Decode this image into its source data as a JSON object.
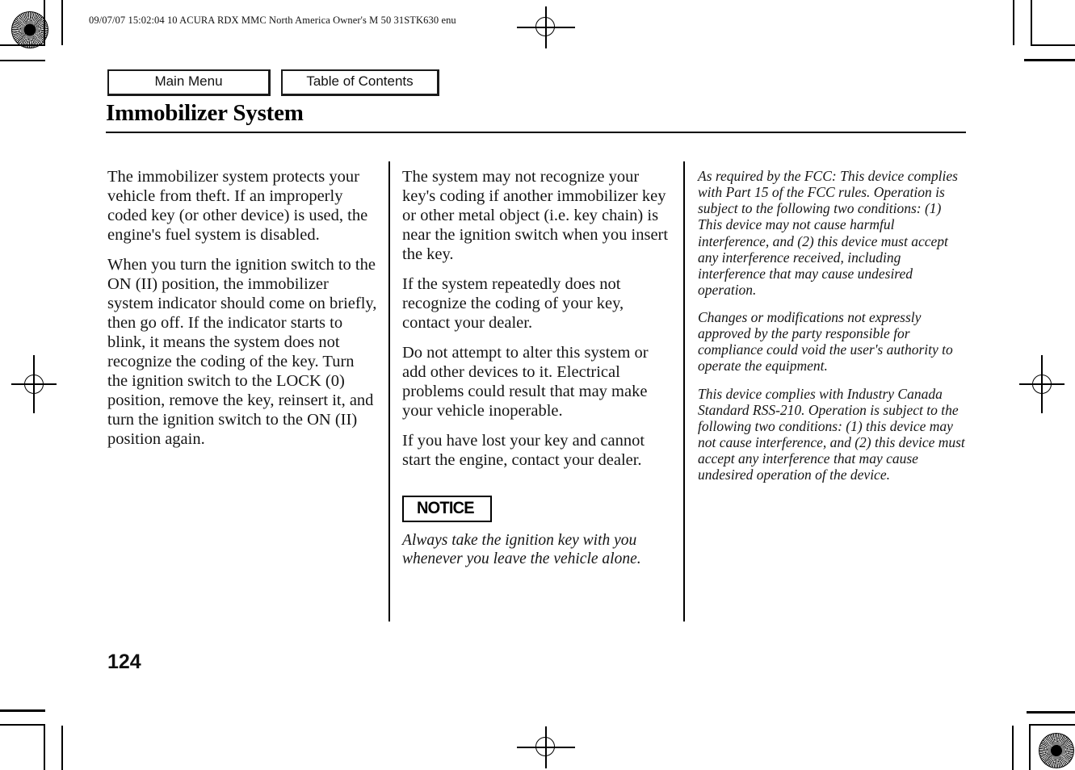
{
  "document": {
    "header_slug": "09/07/07 15:02:04    10 ACURA RDX MMC North America Owner's M 50 31STK630 enu",
    "page_number": "124",
    "title": "Immobilizer System"
  },
  "nav": {
    "main_menu_label": "Main Menu",
    "table_of_contents_label": "Table of Contents"
  },
  "columns": {
    "col1": {
      "paragraphs": [
        "The immobilizer system protects your vehicle from theft. If an improperly coded key (or other device) is used, the engine's fuel system is disabled.",
        "When you turn the ignition switch to the ON (II) position, the immobilizer system indicator should come on briefly, then go off. If the indicator starts to blink, it means the system does not recognize the coding of the key. Turn the ignition switch to the LOCK (0) position, remove the key, reinsert it, and turn the ignition switch to the ON (II) position again."
      ]
    },
    "col2": {
      "paragraphs": [
        "The system may not recognize your key's coding if another immobilizer key or other metal object (i.e. key chain) is near the ignition switch when you insert the key.",
        "If the system repeatedly does not recognize the coding of your key, contact your dealer.",
        "Do not attempt to alter this system or add other devices to it. Electrical problems could result that may make your vehicle inoperable.",
        "If you have lost your key and cannot start the engine, contact your dealer."
      ],
      "notice_label": "NOTICE",
      "notice_text": "Always take the ignition key with you whenever you leave the vehicle alone."
    },
    "col3": {
      "paragraphs": [
        "As required by the FCC: This device complies with Part 15 of the FCC rules. Operation is subject to the following two conditions: (1) This device may not cause harmful interference, and (2) this device must accept any interference received, including interference that may cause undesired operation.",
        "Changes or modifications not expressly approved by the party responsible for compliance could void the user's authority to operate the equipment.",
        "This device complies with Industry Canada Standard RSS-210. Operation is subject to the following two conditions: (1) this device may not cause interference, and (2) this device must accept any interference that may cause undesired operation of the device."
      ]
    }
  },
  "print_marks": {
    "rosette_top_left": "registration-rosette",
    "rosette_bottom_right": "registration-rosette",
    "target_top_center": "registration-target",
    "target_left_center": "registration-target",
    "target_right_center": "registration-target",
    "target_bottom_center": "registration-target"
  },
  "colors": {
    "ink": "#000000",
    "paper": "#ffffff",
    "body_text": "#151515"
  }
}
